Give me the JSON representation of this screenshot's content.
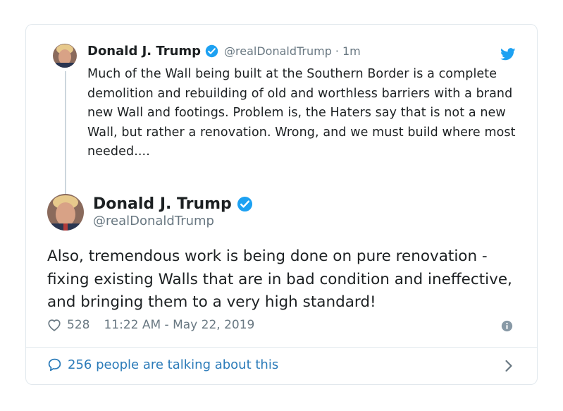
{
  "quoted_tweet": {
    "author_name": "Donald J. Trump",
    "handle": "@realDonaldTrump",
    "separator": "·",
    "time_ago": "1m",
    "text": "Much of the Wall being built at the Southern Border is a complete demolition and rebuilding of old and worthless barriers with a brand new Wall and footings. Problem is, the Haters say that is not a new Wall, but rather a renovation. Wrong, and we must build where most needed...."
  },
  "main_tweet": {
    "author_name": "Donald J. Trump",
    "handle": "@realDonaldTrump",
    "text": "Also, tremendous work is being done on pure renovation - fixing existing Walls that are in bad condition and ineffective, and bringing them to a very high standard!",
    "likes": "528",
    "timestamp": "11:22 AM - May 22, 2019"
  },
  "footer": {
    "talking_label": "256 people are talking about this"
  },
  "colors": {
    "verified_blue": "#1da1f2",
    "link_blue": "#2b7bb9",
    "secondary_text": "#697882",
    "border": "#e1e8ed"
  },
  "icons": [
    "verified-badge-icon",
    "twitter-bird-icon",
    "heart-icon",
    "info-icon",
    "speech-bubble-icon",
    "chevron-right-icon"
  ]
}
